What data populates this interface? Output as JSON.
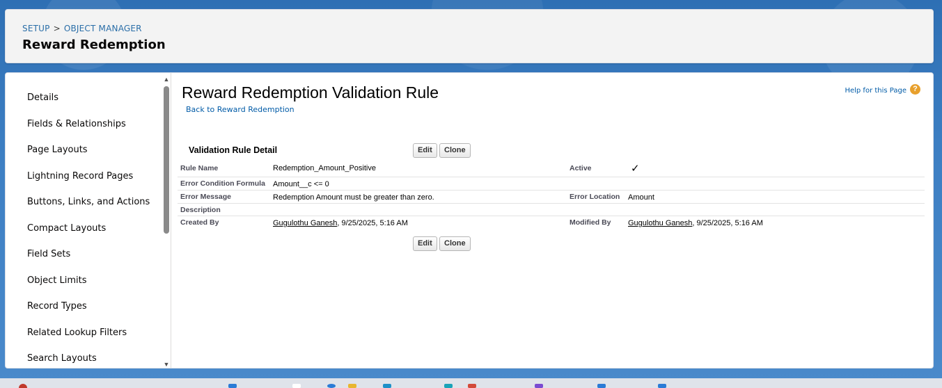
{
  "header": {
    "breadcrumb": {
      "setup": "SETUP",
      "separator": ">",
      "object_manager": "OBJECT MANAGER"
    },
    "title": "Reward Redemption"
  },
  "sidebar": {
    "items": [
      {
        "label": "Details"
      },
      {
        "label": "Fields & Relationships"
      },
      {
        "label": "Page Layouts"
      },
      {
        "label": "Lightning Record Pages"
      },
      {
        "label": "Buttons, Links, and Actions"
      },
      {
        "label": "Compact Layouts"
      },
      {
        "label": "Field Sets"
      },
      {
        "label": "Object Limits"
      },
      {
        "label": "Record Types"
      },
      {
        "label": "Related Lookup Filters"
      },
      {
        "label": "Search Layouts"
      }
    ]
  },
  "content": {
    "page_title": "Reward Redemption Validation Rule",
    "back_link": "Back to Reward Redemption",
    "help_link": "Help for this Page",
    "help_icon": "?",
    "section_title": "Validation Rule Detail",
    "buttons": {
      "edit": "Edit",
      "clone": "Clone"
    },
    "fields": {
      "rule_name_label": "Rule Name",
      "rule_name": "Redemption_Amount_Positive",
      "active_label": "Active",
      "active_mark": "✓",
      "formula_label": "Error Condition Formula",
      "formula": "Amount__c <= 0",
      "error_message_label": "Error Message",
      "error_message": "Redemption Amount must be greater than zero.",
      "error_location_label": "Error Location",
      "error_location": "Amount",
      "description_label": "Description",
      "created_by_label": "Created By",
      "created_by_user": "Gugulothu Ganesh",
      "created_by_date": ", 9/25/2025, 5:16 AM",
      "modified_by_label": "Modified By",
      "modified_by_user": "Gugulothu Ganesh",
      "modified_by_date": ", 9/25/2025, 5:16 AM"
    }
  },
  "colors": {
    "link": "#015ba7",
    "breadcrumb_link": "#2a6ea8",
    "page_bg": "#3d7fc3",
    "help_icon": "#e8a02c"
  }
}
